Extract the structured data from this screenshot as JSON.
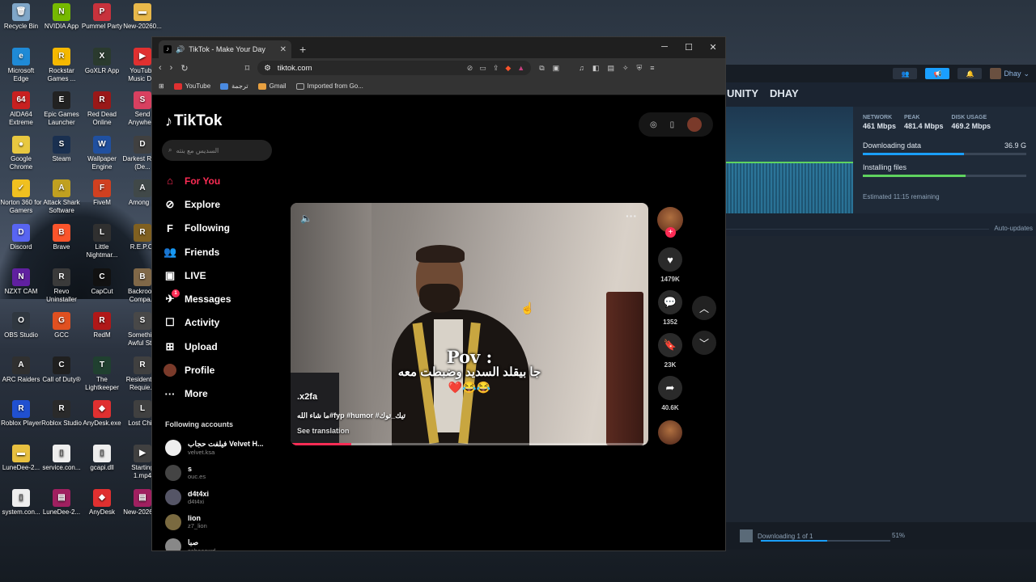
{
  "desktop": {
    "icons": [
      {
        "label": "Recycle Bin",
        "color": "#7fa6c8",
        "glyph": "🗑"
      },
      {
        "label": "NVIDIA App",
        "color": "#76b900",
        "glyph": "N"
      },
      {
        "label": "Pummel Party",
        "color": "#c8323c",
        "glyph": "P"
      },
      {
        "label": "New-20260...",
        "color": "#e8b84a",
        "glyph": "▬"
      },
      {
        "label": "Microsoft Edge",
        "color": "#1f8ad6",
        "glyph": "e"
      },
      {
        "label": "Rockstar Games ...",
        "color": "#f5b800",
        "glyph": "R"
      },
      {
        "label": "GoXLR App",
        "color": "#2a3a2e",
        "glyph": "X"
      },
      {
        "label": "YouTube Music D...",
        "color": "#e03030",
        "glyph": "▶"
      },
      {
        "label": "AIDA64 Extreme",
        "color": "#c82020",
        "glyph": "64"
      },
      {
        "label": "Epic Games Launcher",
        "color": "#222222",
        "glyph": "E"
      },
      {
        "label": "Red Dead Online",
        "color": "#9a1818",
        "glyph": "R"
      },
      {
        "label": "Send Anywhe...",
        "color": "#d84060",
        "glyph": "S"
      },
      {
        "label": "Google Chrome",
        "color": "#e8c840",
        "glyph": "●"
      },
      {
        "label": "Steam",
        "color": "#1a3050",
        "glyph": "S"
      },
      {
        "label": "Wallpaper Engine",
        "color": "#2050a0",
        "glyph": "W"
      },
      {
        "label": "Darkest Road (De...",
        "color": "#404040",
        "glyph": "D"
      },
      {
        "label": "Norton 360 for Gamers",
        "color": "#f0c020",
        "glyph": "✓"
      },
      {
        "label": "Attack Shark Software",
        "color": "#c0a020",
        "glyph": "A"
      },
      {
        "label": "FiveM",
        "color": "#d04020",
        "glyph": "F"
      },
      {
        "label": "Among ...",
        "color": "#404848",
        "glyph": "A"
      },
      {
        "label": "Discord",
        "color": "#5865f2",
        "glyph": "D"
      },
      {
        "label": "Brave",
        "color": "#fb542b",
        "glyph": "B"
      },
      {
        "label": "Little Nightmar...",
        "color": "#303030",
        "glyph": "L"
      },
      {
        "label": "R.E.P.O.",
        "color": "#806020",
        "glyph": "R"
      },
      {
        "label": "NZXT CAM",
        "color": "#6020a0",
        "glyph": "N"
      },
      {
        "label": "Revo Uninstaller",
        "color": "#3a3a3a",
        "glyph": "R"
      },
      {
        "label": "CapCut",
        "color": "#111111",
        "glyph": "C"
      },
      {
        "label": "Backroo... Compa...",
        "color": "#806848",
        "glyph": "B"
      },
      {
        "label": "OBS Studio",
        "color": "#303840",
        "glyph": "O"
      },
      {
        "label": "GCC",
        "color": "#e05020",
        "glyph": "G"
      },
      {
        "label": "RedM",
        "color": "#b01818",
        "glyph": "R"
      },
      {
        "label": "Somethi... Awful St...",
        "color": "#484848",
        "glyph": "S"
      },
      {
        "label": "ARC Raiders",
        "color": "#303030",
        "glyph": "A"
      },
      {
        "label": "Call of Duty®",
        "color": "#202020",
        "glyph": "C"
      },
      {
        "label": "The Lightkeeper",
        "color": "#204030",
        "glyph": "T"
      },
      {
        "label": "Resident ... Requie...",
        "color": "#404040",
        "glyph": "R"
      },
      {
        "label": "Roblox Player",
        "color": "#2050d0",
        "glyph": "R"
      },
      {
        "label": "Roblox Studio",
        "color": "#2a2a2a",
        "glyph": "R"
      },
      {
        "label": "AnyDesk.exe",
        "color": "#e03030",
        "glyph": "◆"
      },
      {
        "label": "Lost Child",
        "color": "#404040",
        "glyph": "L"
      },
      {
        "label": "LuneDee-2...",
        "color": "#e8c040",
        "glyph": "▬"
      },
      {
        "label": "service.con...",
        "color": "#eeeeee",
        "glyph": "▯"
      },
      {
        "label": "gcapi.dll",
        "color": "#eeeeee",
        "glyph": "▯"
      },
      {
        "label": "Starting 1.mp4",
        "color": "#404040",
        "glyph": "▶"
      },
      {
        "label": "system.con...",
        "color": "#eeeeee",
        "glyph": "▯"
      },
      {
        "label": "LuneDee-2...",
        "color": "#a02060",
        "glyph": "▤"
      },
      {
        "label": "AnyDesk",
        "color": "#e03030",
        "glyph": "◆"
      },
      {
        "label": "New-20260...",
        "color": "#a02060",
        "glyph": "▤"
      }
    ]
  },
  "steam": {
    "nav": [
      "UNITY",
      "DHAY"
    ],
    "user": "Dhay",
    "stats": [
      {
        "key": "NETWORK",
        "value": "461 Mbps"
      },
      {
        "key": "PEAK",
        "value": "481.4 Mbps"
      },
      {
        "key": "DISK USAGE",
        "value": "469.2 Mbps"
      }
    ],
    "downloading_label": "Downloading data",
    "downloading_size": "36.9 G",
    "downloading_progress": 0.62,
    "installing_label": "Installing files",
    "installing_progress": 0.63,
    "estimated": "Estimated 11:15 remaining",
    "auto_updates": "Auto-updates",
    "footer_status": "Downloading 1 of 1",
    "footer_percent": "51%",
    "footer_progress": 0.51
  },
  "browser": {
    "tab_title": "TikTok - Make Your Day",
    "url": "tiktok.com",
    "bookmarks": [
      {
        "label": "YouTube",
        "color": "#e03030"
      },
      {
        "label": "ترجمة",
        "color": "#4a8ae0"
      },
      {
        "label": "Gmail",
        "color": "#e8a040"
      },
      {
        "label": "Imported from Go...",
        "color": "#888888"
      }
    ]
  },
  "tiktok": {
    "logo": "TikTok",
    "search_placeholder": "السديس مع بنته",
    "nav": [
      {
        "label": "For You",
        "icon": "⌂",
        "name": "home-icon"
      },
      {
        "label": "Explore",
        "icon": "⊘",
        "name": "compass-icon"
      },
      {
        "label": "Following",
        "icon": "F",
        "name": "following-icon"
      },
      {
        "label": "Friends",
        "icon": "👥",
        "name": "friends-icon"
      },
      {
        "label": "LIVE",
        "icon": "▣",
        "name": "live-icon"
      },
      {
        "label": "Messages",
        "icon": "✈",
        "name": "messages-icon",
        "badge": "1"
      },
      {
        "label": "Activity",
        "icon": "☐",
        "name": "activity-icon"
      },
      {
        "label": "Upload",
        "icon": "⊞",
        "name": "upload-icon"
      },
      {
        "label": "Profile",
        "icon": "",
        "name": "profile-avatar"
      },
      {
        "label": "More",
        "icon": "···",
        "name": "more-icon"
      }
    ],
    "following_title": "Following accounts",
    "following": [
      {
        "name": "فيلفت حجاب Velvet H...",
        "handle": "velvet.ksa"
      },
      {
        "name": "s",
        "handle": "ouc.es"
      },
      {
        "name": "d4t4xi",
        "handle": "d4t4xi"
      },
      {
        "name": "lion",
        "handle": "z7_lion"
      },
      {
        "name": "صبا",
        "handle": "sabaaawd"
      }
    ],
    "video": {
      "caption_line1": "Pov :",
      "caption_line2": "جا بيقلد السديد وضبطت معه",
      "caption_emoji": "❤️😂😂",
      "username": ".x2fa",
      "description": "ما شاء الله#fyp #humor #تيك_توك",
      "see_translation": "See translation",
      "progress": 0.17
    },
    "actions": {
      "likes": "1479K",
      "comments": "1352",
      "saves": "23K",
      "shares": "40.6K"
    }
  }
}
